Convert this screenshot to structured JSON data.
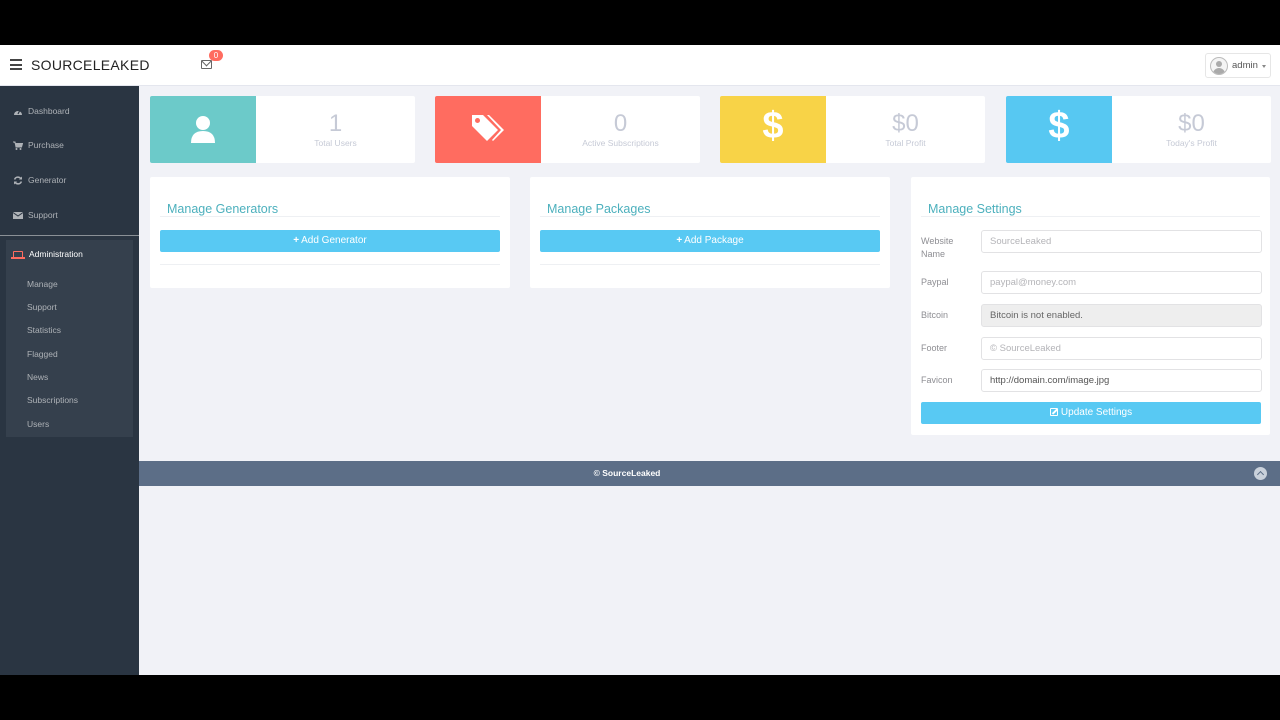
{
  "header": {
    "brand": "SOURCELEAKED",
    "mail_count": "0",
    "user": "admin"
  },
  "sidebar": {
    "items": [
      {
        "label": "Dashboard",
        "icon": "dashboard-icon"
      },
      {
        "label": "Purchase",
        "icon": "cart-icon"
      },
      {
        "label": "Generator",
        "icon": "refresh-icon"
      },
      {
        "label": "Support",
        "icon": "envelope-icon"
      }
    ],
    "admin": {
      "label": "Administration",
      "icon": "laptop-icon",
      "items": [
        "Manage",
        "Support",
        "Statistics",
        "Flagged",
        "News",
        "Subscriptions",
        "Users"
      ]
    }
  },
  "stats": [
    {
      "value": "1",
      "label": "Total Users",
      "color": "#6ccac9",
      "icon": "user-icon"
    },
    {
      "value": "0",
      "label": "Active Subscriptions",
      "color": "#ff6c60",
      "icon": "tags-icon"
    },
    {
      "value": "$0",
      "label": "Total Profit",
      "color": "#f8d347",
      "icon": "dollar-icon"
    },
    {
      "value": "$0",
      "label": "Today's Profit",
      "color": "#57c8f2",
      "icon": "dollar-icon"
    }
  ],
  "generators": {
    "title": "Manage Generators",
    "button": "Add Generator"
  },
  "packages": {
    "title": "Manage Packages",
    "button": "Add Package"
  },
  "settings": {
    "title": "Manage Settings",
    "fields": [
      {
        "label": "Website Name",
        "placeholder": "SourceLeaked",
        "value": ""
      },
      {
        "label": "Paypal",
        "placeholder": "paypal@money.com",
        "value": ""
      },
      {
        "label": "Bitcoin",
        "placeholder": "",
        "value": "Bitcoin is not enabled."
      },
      {
        "label": "Footer",
        "placeholder": "© SourceLeaked",
        "value": ""
      },
      {
        "label": "Favicon",
        "placeholder": "",
        "value": "http://domain.com/image.jpg"
      }
    ],
    "button": "Update Settings"
  },
  "footer": {
    "text": "© SourceLeaked"
  }
}
